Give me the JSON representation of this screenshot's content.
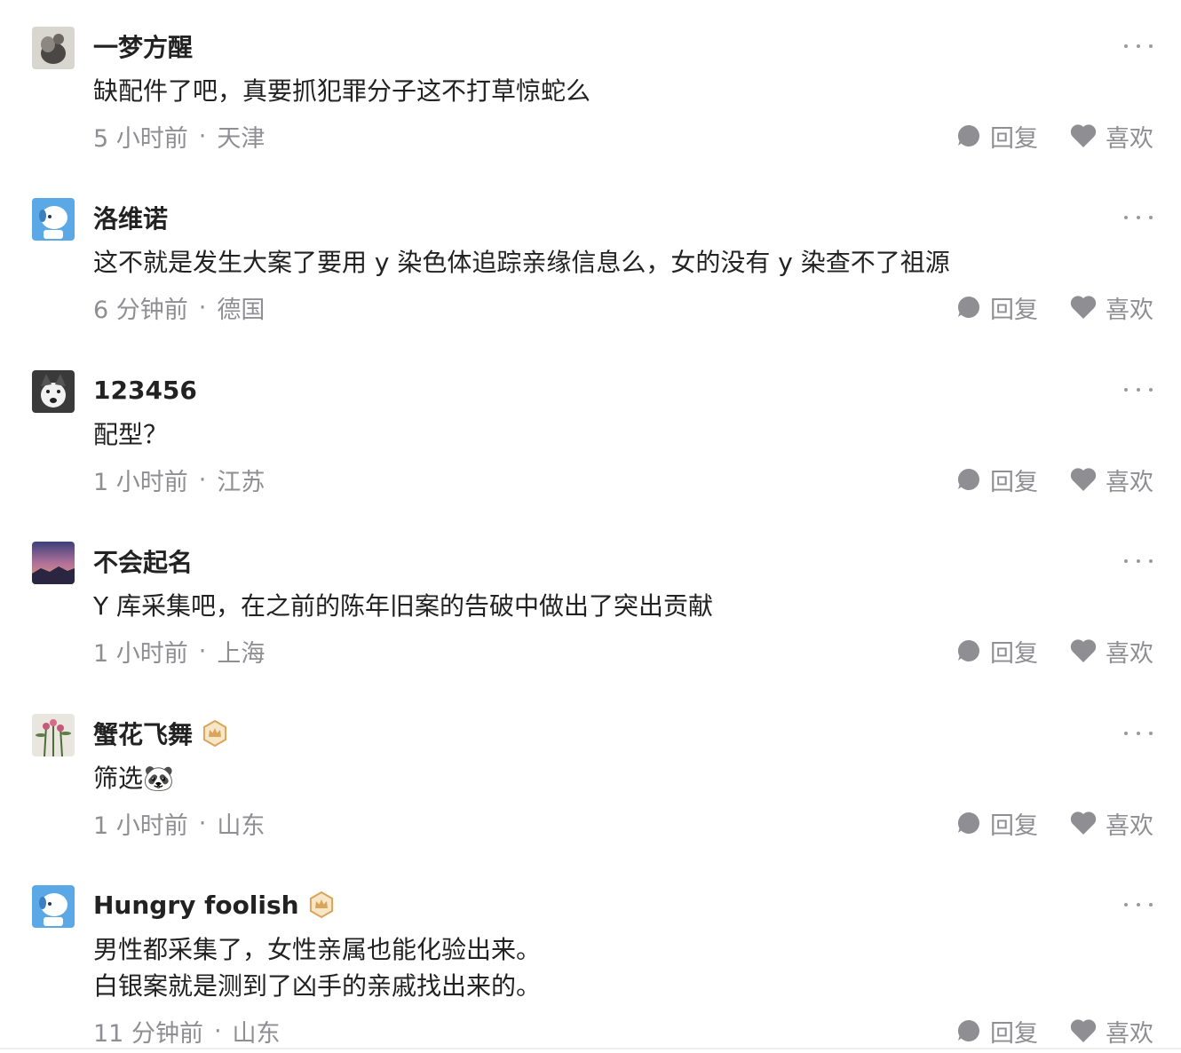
{
  "comments": [
    {
      "username": "一梦方醒",
      "vip": false,
      "avatar_icon": "avatar-grey-photo-icon",
      "text_lines": [
        "缺配件了吧，真要抓犯罪分子这不打草惊蛇么"
      ],
      "time": "5 小时前",
      "location": "天津",
      "reply_label": "回复",
      "like_label": "喜欢"
    },
    {
      "username": "洛维诺",
      "vip": false,
      "avatar_icon": "avatar-blue-dog-icon",
      "text_lines": [
        "这不就是发生大案了要用 y 染色体追踪亲缘信息么，女的没有 y 染查不了祖源"
      ],
      "time": "6 分钟前",
      "location": "德国",
      "reply_label": "回复",
      "like_label": "喜欢"
    },
    {
      "username": "123456",
      "vip": false,
      "avatar_icon": "avatar-husky-icon",
      "text_lines": [
        "配型？"
      ],
      "time": "1 小时前",
      "location": "江苏",
      "reply_label": "回复",
      "like_label": "喜欢"
    },
    {
      "username": "不会起名",
      "vip": false,
      "avatar_icon": "avatar-sunset-icon",
      "text_lines": [
        "Y 库采集吧，在之前的陈年旧案的告破中做出了突出贡献"
      ],
      "time": "1 小时前",
      "location": "上海",
      "reply_label": "回复",
      "like_label": "喜欢"
    },
    {
      "username": "蟹花飞舞",
      "vip": true,
      "avatar_icon": "avatar-flowers-icon",
      "text_lines": [
        "筛选🐼"
      ],
      "time": "1 小时前",
      "location": "山东",
      "reply_label": "回复",
      "like_label": "喜欢"
    },
    {
      "username": "Hungry foolish",
      "vip": true,
      "avatar_icon": "avatar-blue-dog-icon",
      "text_lines": [
        "男性都采集了，女性亲属也能化验出来。",
        "白银案就是测到了凶手的亲戚找出来的。"
      ],
      "time": "11 分钟前",
      "location": "山东",
      "reply_label": "回复",
      "like_label": "喜欢"
    }
  ],
  "meta_separator": "·",
  "colors": {
    "meta_grey": "#8e8e93",
    "text": "#222222",
    "vip_gold": "#d9a55a",
    "action_icon": "#8e8e93"
  }
}
